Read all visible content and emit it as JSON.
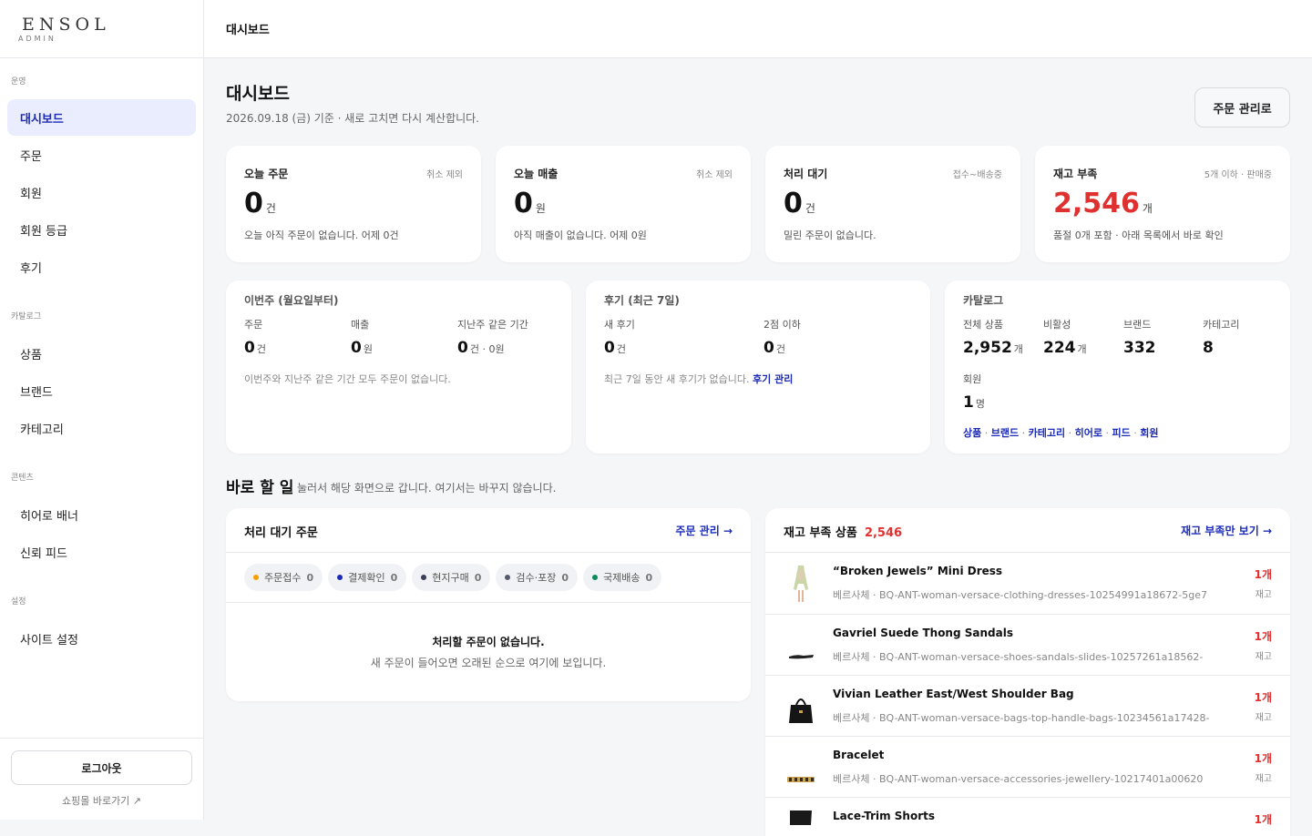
{
  "brand": {
    "name": "ENSOL",
    "sub": "ADMIN"
  },
  "sidebar": {
    "sections": [
      {
        "label": "운영",
        "items": [
          "대시보드",
          "주문",
          "회원",
          "회원 등급",
          "후기"
        ]
      },
      {
        "label": "카탈로그",
        "items": [
          "상품",
          "브랜드",
          "카테고리"
        ]
      },
      {
        "label": "콘텐츠",
        "items": [
          "히어로 배너",
          "신뢰 피드"
        ]
      },
      {
        "label": "설정",
        "items": [
          "사이트 설정"
        ]
      }
    ],
    "logout": "로그아웃",
    "shop_link": "쇼핑몰 바로가기 ↗"
  },
  "topbar": {
    "title": "대시보드"
  },
  "header": {
    "title": "대시보드",
    "subtitle": "2026.09.18 (금) 기준 · 새로 고치면 다시 계산합니다.",
    "orders_button": "주문 관리로"
  },
  "stats": [
    {
      "label": "오늘 주문",
      "note": "취소 제외",
      "value": "0",
      "unit": "건",
      "desc": "오늘 아직 주문이 없습니다. 어제 0건"
    },
    {
      "label": "오늘 매출",
      "note": "취소 제외",
      "value": "0",
      "unit": "원",
      "desc": "아직 매출이 없습니다. 어제 0원"
    },
    {
      "label": "처리 대기",
      "note": "접수~배송중",
      "value": "0",
      "unit": "건",
      "desc": "밀린 주문이 없습니다."
    },
    {
      "label": "재고 부족",
      "note": "5개 이하 · 판매중",
      "value": "2,546",
      "unit": "개",
      "desc": "품절 0개 포함 · 아래 목록에서 바로 확인"
    }
  ],
  "week": {
    "title": "이번주 (월요일부터)",
    "orders_label": "주문",
    "orders_value": "0",
    "orders_unit": "건",
    "sales_label": "매출",
    "sales_value": "0",
    "sales_unit": "원",
    "prev_label": "지난주 같은 기간",
    "prev_value": "0",
    "prev_unit": "건 · 0원",
    "note": "이번주와 지난주 같은 기간 모두 주문이 없습니다."
  },
  "reviews": {
    "title": "후기 (최근 7일)",
    "new_label": "새 후기",
    "new_value": "0",
    "new_unit": "건",
    "low_label": "2점 이하",
    "low_value": "0",
    "low_unit": "건",
    "note": "최근 7일 동안 새 후기가 없습니다.",
    "link": "후기 관리"
  },
  "catalog": {
    "title": "카탈로그",
    "total_label": "전체 상품",
    "total_value": "2,952",
    "total_unit": "개",
    "inactive_label": "비활성",
    "inactive_value": "224",
    "inactive_unit": "개",
    "brand_label": "브랜드",
    "brand_value": "332",
    "category_label": "카테고리",
    "category_value": "8",
    "member_label": "회원",
    "member_value": "1",
    "member_unit": "명",
    "links": [
      "상품",
      "브랜드",
      "카테고리",
      "히어로",
      "피드",
      "회원"
    ]
  },
  "todo": {
    "title": "바로 할 일",
    "subtitle": "눌러서 해당 화면으로 갑니다. 여기서는 바꾸지 않습니다."
  },
  "pending": {
    "title": "처리 대기 주문",
    "action": "주문 관리 →",
    "chips": [
      {
        "label": "주문접수",
        "count": "0",
        "color": "#f59f00"
      },
      {
        "label": "결제확인",
        "count": "0",
        "color": "#1b2bb8"
      },
      {
        "label": "현지구매",
        "count": "0",
        "color": "#3a3f5a"
      },
      {
        "label": "검수·포장",
        "count": "0",
        "color": "#555a6e"
      },
      {
        "label": "국제배송",
        "count": "0",
        "color": "#0c8a5c"
      }
    ],
    "empty_title": "처리할 주문이 없습니다.",
    "empty_sub": "새 주문이 들어오면 오래된 순으로 여기에 보입니다."
  },
  "low_stock": {
    "title": "재고 부족 상품",
    "count": "2,546",
    "action": "재고 부족만 보기 →",
    "items": [
      {
        "name": "“Broken Jewels” Mini Dress",
        "sku": "베르사체 · BQ-ANT-woman-versace-clothing-dresses-10254991a18672-5ge7",
        "qty": "1개",
        "qty_label": "재고",
        "icon": "dress-thumbnail"
      },
      {
        "name": "Gavriel Suede Thong Sandals",
        "sku": "베르사체 · BQ-ANT-woman-versace-shoes-sandals-slides-10257261a18562-",
        "qty": "1개",
        "qty_label": "재고",
        "icon": "sandal-thumbnail"
      },
      {
        "name": "Vivian Leather East/West Shoulder Bag",
        "sku": "베르사체 · BQ-ANT-woman-versace-bags-top-handle-bags-10234561a17428-",
        "qty": "1개",
        "qty_label": "재고",
        "icon": "bag-thumbnail"
      },
      {
        "name": "Bracelet",
        "sku": "베르사체 · BQ-ANT-woman-versace-accessories-jewellery-10217401a00620",
        "qty": "1개",
        "qty_label": "재고",
        "icon": "bracelet-thumbnail"
      },
      {
        "name": "Lace-Trim Shorts",
        "sku": "",
        "qty": "1개",
        "qty_label": "",
        "icon": "shorts-thumbnail"
      }
    ]
  },
  "colors": {
    "accent": "#1b2bb8",
    "danger": "#e03131",
    "active_bg": "#eaedfd"
  }
}
